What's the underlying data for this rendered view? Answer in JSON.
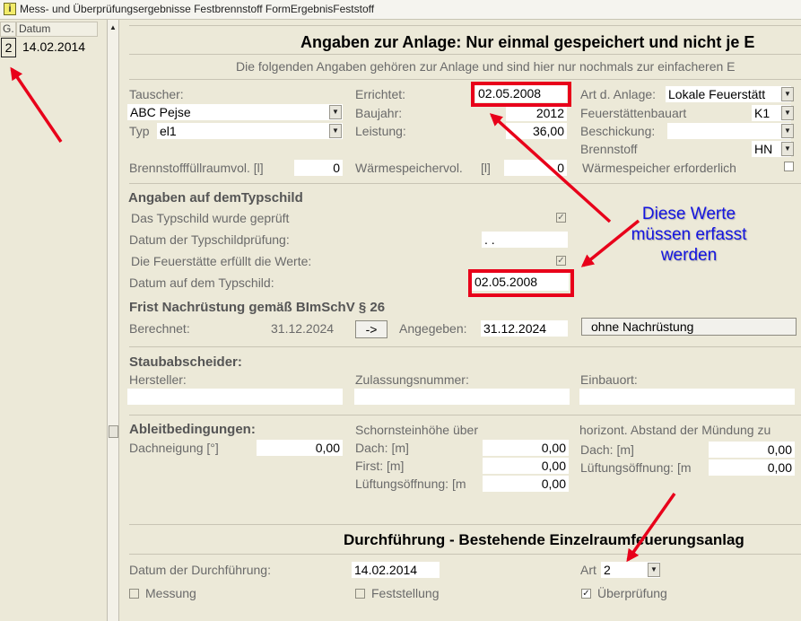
{
  "window": {
    "title": "Mess- und Überprüfungsergebnisse Festbrennstoff FormErgebnisFeststoff",
    "icon_char": "i"
  },
  "left_grid": {
    "headers": [
      "G.",
      "Datum"
    ],
    "row": {
      "g": "2",
      "date": "14.02.2014"
    }
  },
  "anlage": {
    "title": "Angaben zur Anlage: Nur einmal gespeichert und nicht je E",
    "subtitle": "Die folgenden Angaben gehören zur Anlage und sind hier nur nochmals zur einfacheren E",
    "tauscher_label": "Tauscher:",
    "tauscher_value": "ABC Pejse",
    "typ_label": "Typ",
    "typ_value": "el1",
    "errichtet_label": "Errichtet:",
    "errichtet_value": "02.05.2008",
    "baujahr_label": "Baujahr:",
    "baujahr_value": "2012",
    "leistung_label": "Leistung:",
    "leistung_value": "36,00",
    "art_label": "Art d. Anlage:",
    "art_value": "Lokale Feuerstätt",
    "bauart_label": "Feuerstättenbauart",
    "bauart_value": "K1",
    "beschickung_label": "Beschickung:",
    "beschickung_value": "",
    "brennstoff_label": "Brennstoff",
    "brennstoff_value": "HN",
    "fuellraum_label": "Brennstofffüllraumvol. [l]",
    "fuellraum_value": "0",
    "waermespeicher_label": "Wärmespeichervol.",
    "waermespeicher_unit": "[l]",
    "waermespeicher_value": "0",
    "speicher_erf_label": "Wärmespeicher erforderlich"
  },
  "typschild": {
    "header": "Angaben auf demTypschild",
    "geprueft_label": "Das Typschild wurde geprüft",
    "datum_pruefung_label": "Datum der Typschildprüfung:",
    "datum_pruefung_value": ". .",
    "erfuellt_label": "Die Feuerstätte erfüllt die Werte:",
    "datum_typschild_label": "Datum auf dem Typschild:",
    "datum_typschild_value": "02.05.2008"
  },
  "frist": {
    "header": "Frist Nachrüstung gemäß BImSchV § 26",
    "berechnet_label": "Berechnet:",
    "berechnet_value": "31.12.2024",
    "arrow_button": "->",
    "angegeben_label": "Angegeben:",
    "angegeben_value": "31.12.2024",
    "ohne_button": "ohne Nachrüstung"
  },
  "staub": {
    "header": "Staubabscheider:",
    "hersteller_label": "Hersteller:",
    "zulassung_label": "Zulassungsnummer:",
    "einbauort_label": "Einbauort:"
  },
  "ableit": {
    "header": "Ableitbedingungen:",
    "dachneigung_label": "Dachneigung [°]",
    "dachneigung_value": "0,00",
    "schornstein_label": "Schornsteinhöhe über",
    "dach_label": "Dach: [m]",
    "dach_value": "0,00",
    "first_label": "First: [m]",
    "first_value": "0,00",
    "lueftung_label": "Lüftungsöffnung: [m",
    "lueftung_value": "0,00",
    "horiz_label": "horizont. Abstand der Mündung zu",
    "h_dach_label": "Dach: [m]",
    "h_dach_value": "0,00",
    "h_lueftung_label": "Lüftungsöffnung: [m",
    "h_lueftung_value": "0,00"
  },
  "durchfuehrung": {
    "title": "Durchführung - Bestehende Einzelraumfeuerungsanlag",
    "datum_label": "Datum der Durchführung:",
    "datum_value": "14.02.2014",
    "art_label": "Art",
    "art_value": "2",
    "messung_label": "Messung",
    "feststellung_label": "Feststellung",
    "ueberpruefung_label": "Überprüfung"
  },
  "annotation": {
    "lines": [
      "Diese Werte",
      "müssen erfasst",
      "werden"
    ]
  },
  "colors": {
    "highlight": "#e8001a",
    "annotation_text": "#1414e0",
    "background": "#ece9d8"
  }
}
